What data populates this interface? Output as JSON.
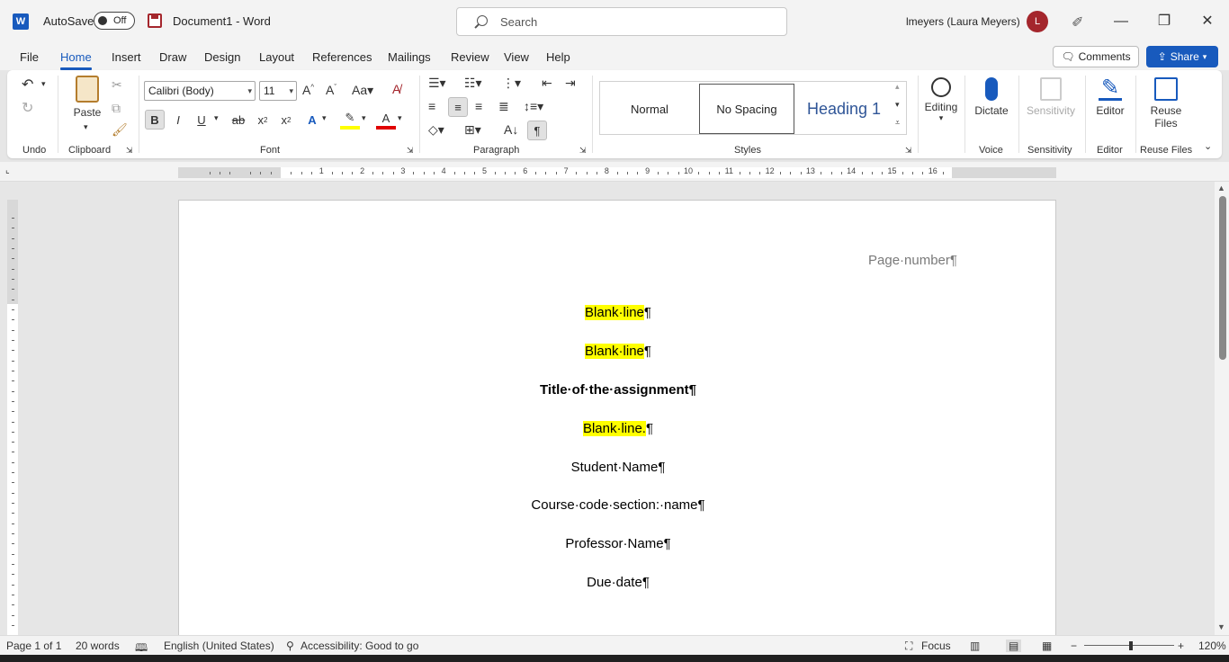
{
  "titlebar": {
    "autosave_label": "AutoSave",
    "autosave_state": "Off",
    "document_title": "Document1  -  Word",
    "search_placeholder": "Search",
    "user_name": "lmeyers (Laura Meyers)",
    "avatar_initial": "L"
  },
  "menu": {
    "tabs": [
      "File",
      "Home",
      "Insert",
      "Draw",
      "Design",
      "Layout",
      "References",
      "Mailings",
      "Review",
      "View",
      "Help"
    ],
    "active_tab": "Home",
    "comments_label": "Comments",
    "share_label": "Share"
  },
  "ribbon": {
    "groups": {
      "undo": "Undo",
      "clipboard": "Clipboard",
      "font": "Font",
      "paragraph": "Paragraph",
      "styles": "Styles",
      "voice": "Voice",
      "sensitivity": "Sensitivity",
      "editor": "Editor",
      "reuse_files": "Reuse Files"
    },
    "paste_label": "Paste",
    "font_name": "Calibri (Body)",
    "font_size": "11",
    "styles": [
      "Normal",
      "No Spacing",
      "Heading 1"
    ],
    "selected_style": "No Spacing",
    "editing_label": "Editing",
    "dictate_label": "Dictate",
    "sensitivity_label": "Sensitivity",
    "editor_label": "Editor",
    "reuse_label_1": "Reuse",
    "reuse_label_2": "Files"
  },
  "ruler": {
    "numbers": [
      "1",
      "2",
      "3",
      "4",
      "5",
      "6",
      "7",
      "8",
      "9",
      "10",
      "11",
      "12",
      "13",
      "14",
      "15",
      "16"
    ]
  },
  "document": {
    "header": "Page·number¶",
    "paragraphs": [
      {
        "text": "Blank·line",
        "mark": "¶",
        "highlight": true,
        "bold": false
      },
      {
        "text": "Blank·line",
        "mark": "¶",
        "highlight": true,
        "bold": false
      },
      {
        "text": "Title·of·the·assignment",
        "mark": "¶",
        "highlight": false,
        "bold": true
      },
      {
        "text": "Blank·line.",
        "mark": "¶",
        "highlight": true,
        "bold": false
      },
      {
        "text": "Student·Name",
        "mark": "¶",
        "highlight": false,
        "bold": false
      },
      {
        "text": "Course·code·section:·name",
        "mark": "¶",
        "highlight": false,
        "bold": false
      },
      {
        "text": "Professor·Name",
        "mark": "¶",
        "highlight": false,
        "bold": false
      },
      {
        "text": "Due·date",
        "mark": "¶",
        "highlight": false,
        "bold": false
      }
    ],
    "highlight_color": "#ffff00"
  },
  "status": {
    "page": "Page 1 of 1",
    "words": "20 words",
    "language": "English (United States)",
    "accessibility": "Accessibility: Good to go",
    "focus": "Focus",
    "zoom": "120%"
  },
  "colors": {
    "accent": "#185abd",
    "avatar": "#a4262c"
  }
}
